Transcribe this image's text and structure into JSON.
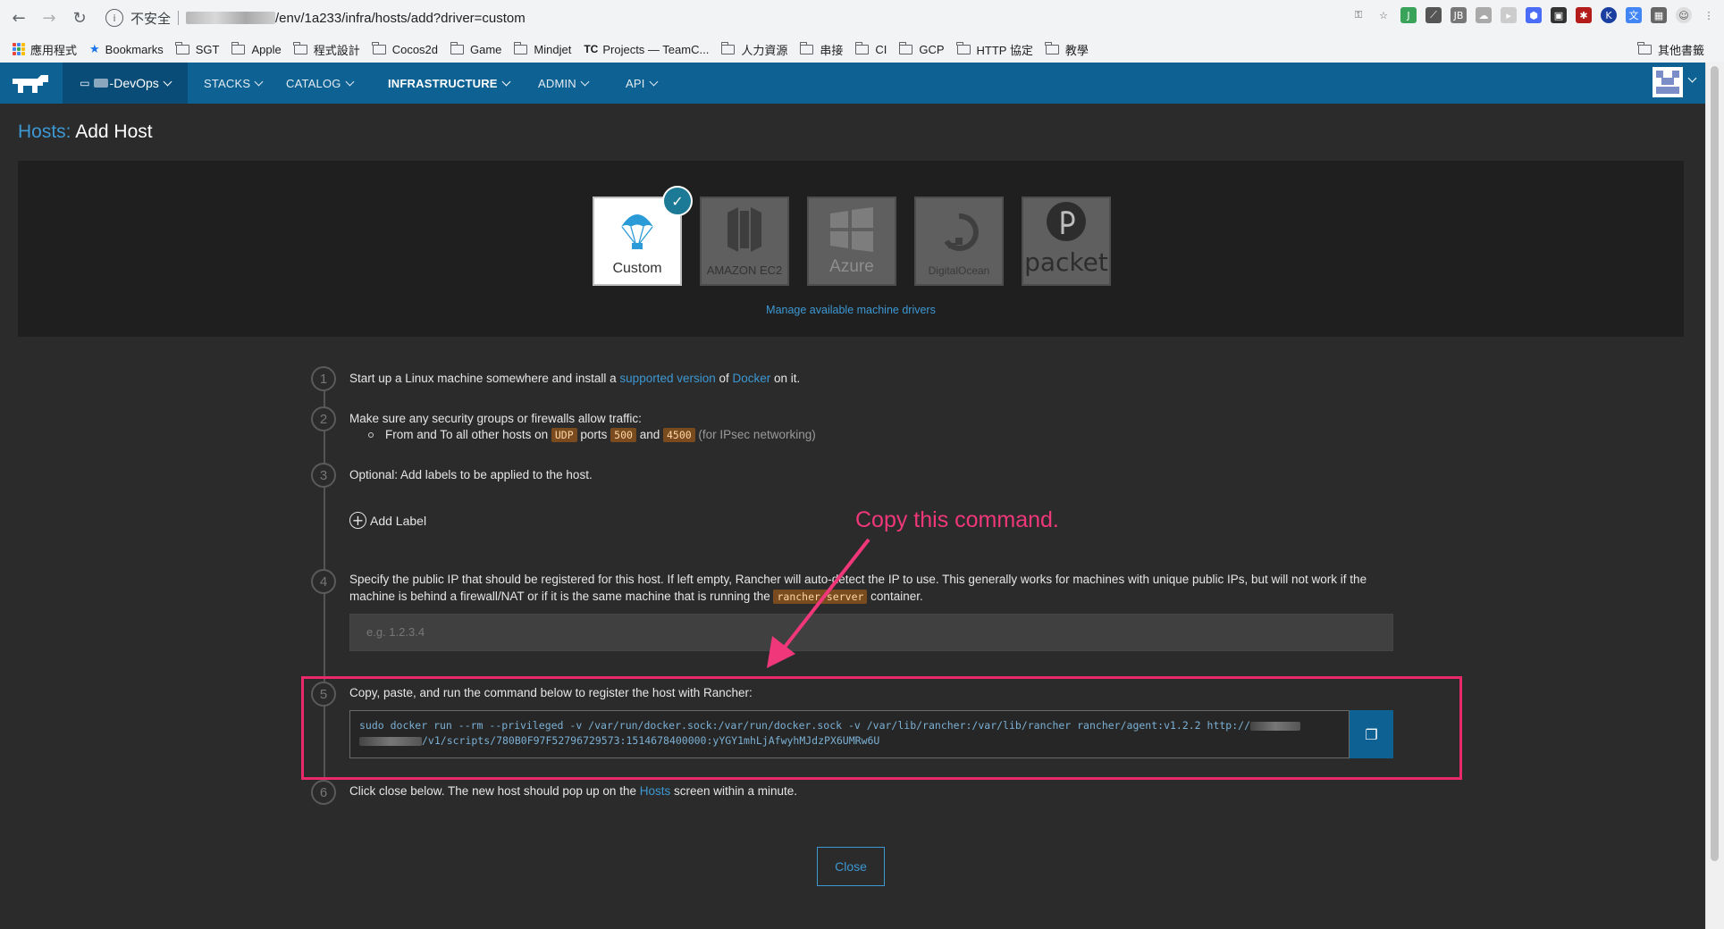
{
  "browser": {
    "insecure_label": "不安全",
    "url": "/env/1a233/infra/hosts/add?driver=custom",
    "bookmarks": [
      {
        "label": "應用程式",
        "icon": "apps-icon"
      },
      {
        "label": "Bookmarks",
        "icon": "star-icon"
      },
      {
        "label": "SGT",
        "icon": "folder-icon"
      },
      {
        "label": "Apple",
        "icon": "folder-icon"
      },
      {
        "label": "程式設計",
        "icon": "folder-icon"
      },
      {
        "label": "Cocos2d",
        "icon": "folder-icon"
      },
      {
        "label": "Game",
        "icon": "folder-icon"
      },
      {
        "label": "Mindjet",
        "icon": "folder-icon"
      },
      {
        "label": "Projects — TeamC...",
        "icon": "teamcity-icon"
      },
      {
        "label": "人力資源",
        "icon": "folder-icon"
      },
      {
        "label": "串接",
        "icon": "folder-icon"
      },
      {
        "label": "CI",
        "icon": "folder-icon"
      },
      {
        "label": "GCP",
        "icon": "folder-icon"
      },
      {
        "label": "HTTP 協定",
        "icon": "folder-icon"
      },
      {
        "label": "教學",
        "icon": "folder-icon"
      }
    ],
    "other_bookmarks": "其他書籤"
  },
  "header": {
    "env_name": "-DevOps",
    "nav": [
      "STACKS",
      "CATALOG",
      "INFRASTRUCTURE",
      "ADMIN",
      "API"
    ],
    "active_nav": "INFRASTRUCTURE",
    "brand_color": "#0e6193"
  },
  "page": {
    "breadcrumb": "Hosts:",
    "title": "Add Host",
    "drivers": [
      {
        "label": "Custom",
        "selected": true
      },
      {
        "label": "AMAZON EC2",
        "selected": false
      },
      {
        "label": "Azure",
        "selected": false
      },
      {
        "label": "DigitalOcean",
        "selected": false
      },
      {
        "label": "packet",
        "selected": false
      }
    ],
    "manage_link": "Manage available machine drivers",
    "steps": {
      "s1": {
        "num": "1",
        "pre": "Start up a Linux machine somewhere and install a ",
        "link1": "supported version",
        "mid": " of ",
        "link2": "Docker",
        "post": " on it."
      },
      "s2": {
        "num": "2",
        "text": "Make sure any security groups or firewalls allow traffic:",
        "b_pre": "From and To all other hosts on ",
        "udp": "UDP",
        "ports": " ports ",
        "p1": "500",
        "and": " and ",
        "p2": "4500",
        "note": " (for IPsec networking)"
      },
      "s3": {
        "num": "3",
        "text": "Optional: Add labels to be applied to the host.",
        "add_label": "Add Label"
      },
      "s4": {
        "num": "4",
        "pre": "Specify the public IP that should be registered for this host. If left empty, Rancher will auto-detect the IP to use. This generally works for machines with unique public IPs, but will not work if the machine is behind a firewall/NAT or if it is the same machine that is running the ",
        "code": "rancher/server",
        "post": " container.",
        "placeholder": "e.g. 1.2.3.4"
      },
      "s5": {
        "num": "5",
        "text": "Copy, paste, and run the command below to register the host with Rancher:",
        "cmd_line1": "sudo docker run --rm --privileged -v /var/run/docker.sock:/var/run/docker.sock -v /var/lib/rancher:/var/lib/rancher rancher/agent:v1.2.2 http://",
        "cmd_line2": "/v1/scripts/780B0F97F52796729573:1514678400000:yYGY1mhLjAfwyhMJdzPX6UMRw6U"
      },
      "s6": {
        "num": "6",
        "pre": "Click close below. The new host should pop up on the ",
        "link": "Hosts",
        "post": " screen within a minute."
      }
    },
    "annotation": "Copy this  command.",
    "annotation_color": "#f0377a",
    "close_label": "Close"
  }
}
